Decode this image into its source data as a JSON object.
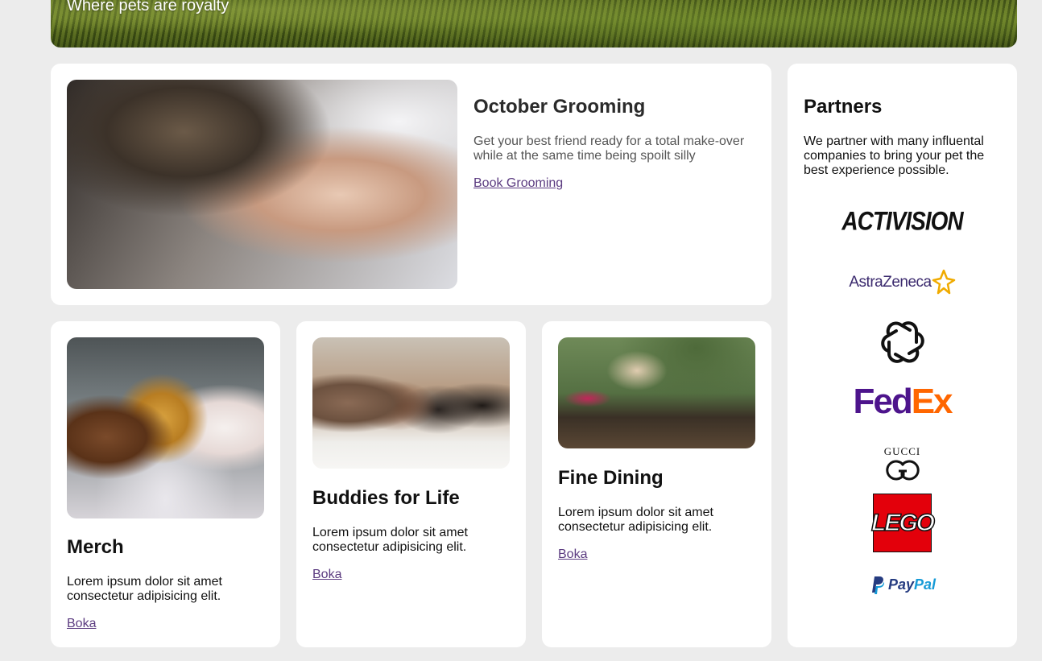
{
  "hero": {
    "tagline": "Where pets are royalty"
  },
  "feature": {
    "image_alt": "Dog being groomed with scissors",
    "title": "October Grooming",
    "text": "Get your best friend ready for a total make-over while at the same time being spoilt silly",
    "link_label": "Book Grooming"
  },
  "cards": [
    {
      "image_alt": "Three dachshunds wearing knitted animal hats",
      "title": "Merch",
      "text": "Lorem ipsum dolor sit amet consectetur adipisicing elit.",
      "link_label": "Boka"
    },
    {
      "image_alt": "Four dogs lying on a bed",
      "title": "Buddies for Life",
      "text": "Lorem ipsum dolor sit amet consectetur adipisicing elit.",
      "link_label": "Boka"
    },
    {
      "image_alt": "Small dog at an outdoor dinner table with a cocktail",
      "title": "Fine Dining",
      "text": "Lorem ipsum dolor sit amet consectetur adipisicing elit.",
      "link_label": "Boka"
    }
  ],
  "partners": {
    "title": "Partners",
    "text": "We partner with many influental companies to bring your pet the best experience possible.",
    "logos": [
      {
        "name": "activision-logo",
        "label": "ACTIVISION"
      },
      {
        "name": "astrazeneca-logo",
        "label": "AstraZeneca"
      },
      {
        "name": "openai-logo",
        "label": ""
      },
      {
        "name": "fedex-logo",
        "label": "FedEx"
      },
      {
        "name": "gucci-logo",
        "label": "GUCCI"
      },
      {
        "name": "lego-logo",
        "label": "LEGO"
      },
      {
        "name": "paypal-logo",
        "label": "PayPal"
      }
    ]
  },
  "colors": {
    "page_background": "#ececec",
    "card_background": "#ffffff",
    "link": "#5b3b80",
    "fedex_purple": "#4d148c",
    "fedex_orange": "#ff6600",
    "lego_red": "#e3000b",
    "paypal_dark": "#253b80",
    "paypal_light": "#179bd7"
  }
}
